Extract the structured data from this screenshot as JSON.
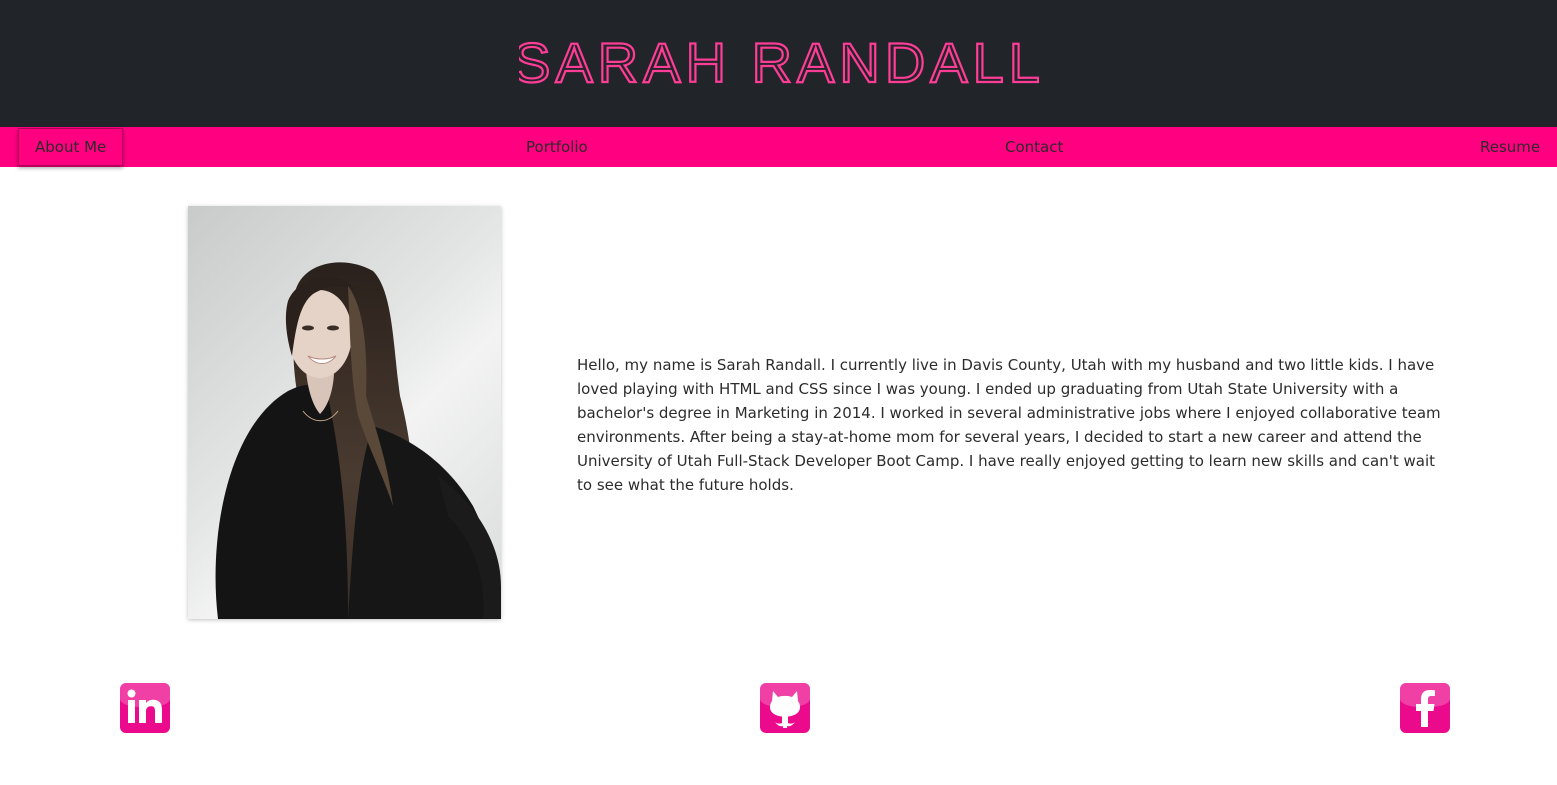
{
  "header": {
    "title": "Sarah Randall"
  },
  "nav": {
    "items": [
      {
        "label": "About Me",
        "active": true
      },
      {
        "label": "Portfolio",
        "active": false
      },
      {
        "label": "Contact",
        "active": false
      },
      {
        "label": "Resume",
        "active": false
      }
    ]
  },
  "about": {
    "bio": "Hello, my name is Sarah Randall. I currently live in Davis County, Utah with my husband and two little kids. I have loved playing with HTML and CSS since I was young. I ended up graduating from Utah State University with a bachelor's degree in Marketing in 2014. I worked in several administrative jobs where I enjoyed collaborative team environments. After being a stay-at-home mom for several years, I decided to start a new career and attend the University of Utah Full-Stack Developer Boot Camp. I have really enjoyed getting to learn new skills and can't wait to see what the future holds."
  },
  "social": {
    "icons": [
      "linkedin-icon",
      "github-icon",
      "facebook-icon"
    ]
  },
  "colors": {
    "header_bg": "#212428",
    "accent": "#ff0080",
    "title_outline": "#ff3c96",
    "icon_bg": "#ec0a8c"
  }
}
